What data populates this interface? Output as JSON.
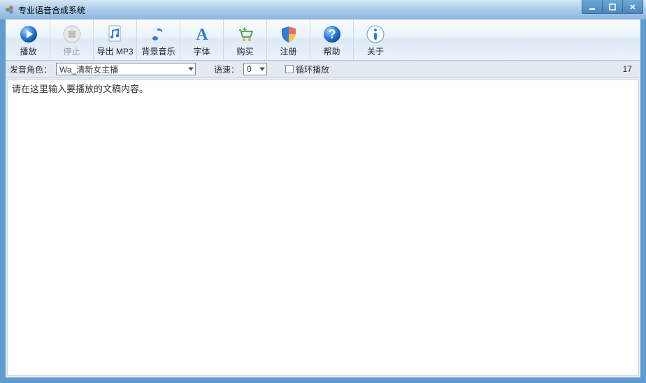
{
  "app": {
    "title": "专业语音合成系统"
  },
  "toolbar": {
    "items": [
      {
        "id": "play",
        "label": "播放"
      },
      {
        "id": "stop",
        "label": "停止"
      },
      {
        "id": "export",
        "label": "导出 MP3"
      },
      {
        "id": "bgm",
        "label": "背景音乐"
      },
      {
        "id": "font",
        "label": "字体"
      },
      {
        "id": "buy",
        "label": "购买"
      },
      {
        "id": "register",
        "label": "注册"
      },
      {
        "id": "help",
        "label": "帮助"
      },
      {
        "id": "about",
        "label": "关于"
      }
    ]
  },
  "options": {
    "voice_label": "发音角色：",
    "voice_selected": "Wa_清新女主播",
    "speed_label": "语速：",
    "speed_value": "0",
    "loop_label": "循环播放",
    "loop_checked": false,
    "char_count": "17"
  },
  "editor": {
    "placeholder": "请在这里输入要播放的文稿内容。"
  }
}
